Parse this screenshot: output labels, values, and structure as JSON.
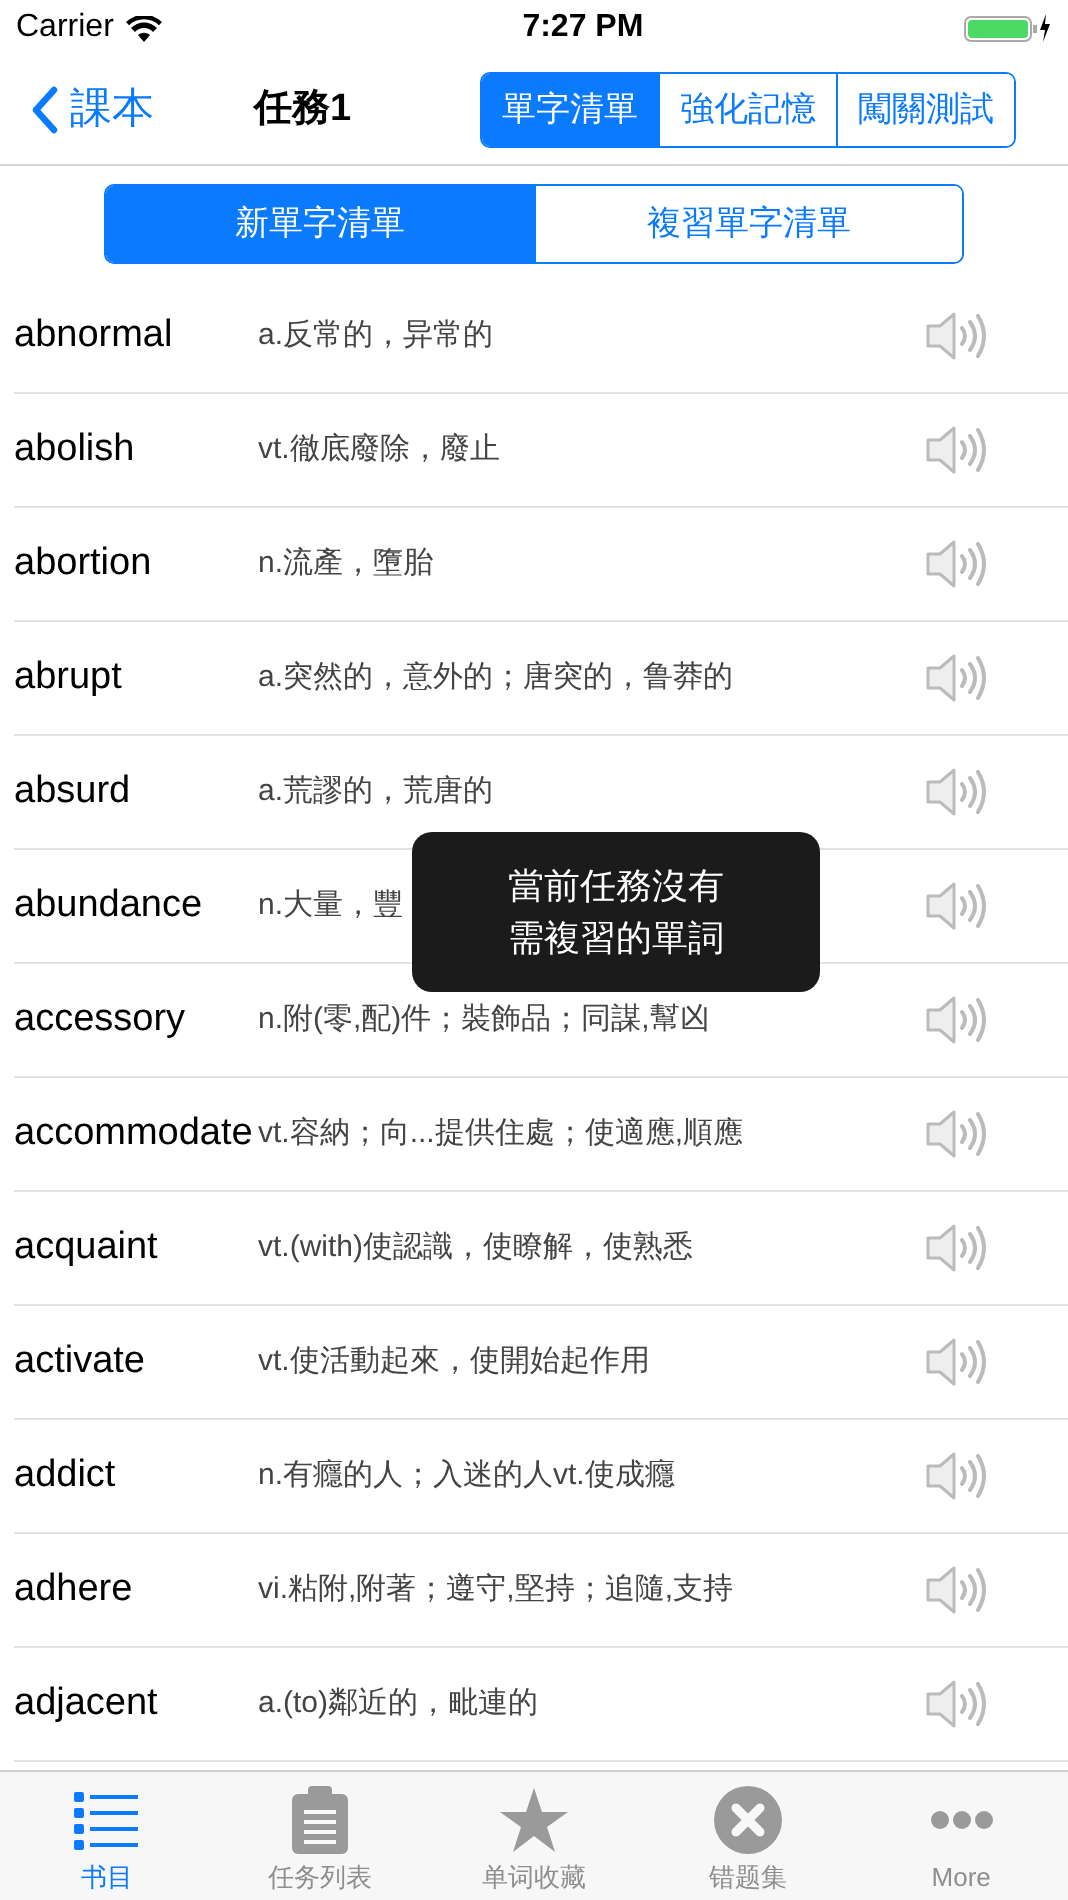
{
  "status_bar": {
    "carrier": "Carrier",
    "time": "7:27 PM"
  },
  "nav": {
    "back": "課本",
    "title": "任務1",
    "segments": [
      {
        "label": "單字清單",
        "selected": true
      },
      {
        "label": "強化記憶",
        "selected": false
      },
      {
        "label": "闖關測試",
        "selected": false
      }
    ]
  },
  "list_tabs": [
    {
      "label": "新單字清單",
      "selected": true
    },
    {
      "label": "複習單字清單",
      "selected": false
    }
  ],
  "words": [
    {
      "word": "abnormal",
      "definition": "a.反常的，异常的"
    },
    {
      "word": "abolish",
      "definition": "vt.徹底廢除，廢止"
    },
    {
      "word": "abortion",
      "definition": "n.流產，墮胎"
    },
    {
      "word": "abrupt",
      "definition": "a.突然的，意外的；唐突的，鲁莽的"
    },
    {
      "word": "absurd",
      "definition": "a.荒謬的，荒唐的"
    },
    {
      "word": "abundance",
      "definition": "n.大量，豐"
    },
    {
      "word": "accessory",
      "definition": "n.附(零,配)件；裝飾品；同謀,幫凶"
    },
    {
      "word": "accommodate",
      "definition": "vt.容納；向...提供住處；使適應,順應"
    },
    {
      "word": "acquaint",
      "definition": "vt.(with)使認識，使瞭解，使熟悉"
    },
    {
      "word": "activate",
      "definition": "vt.使活動起來，使開始起作用"
    },
    {
      "word": "addict",
      "definition": "n.有癮的人；入迷的人vt.使成癮"
    },
    {
      "word": "adhere",
      "definition": "vi.粘附,附著；遵守,堅持；追隨,支持"
    },
    {
      "word": "adjacent",
      "definition": "a.(to)鄰近的，毗連的"
    }
  ],
  "toast": {
    "lines": [
      "當前任務沒有",
      "需複習的單詞"
    ]
  },
  "tab_bar": [
    {
      "label": "书目",
      "kind": "list",
      "selected": true
    },
    {
      "label": "任务列表",
      "kind": "clipboard",
      "selected": false
    },
    {
      "label": "单词收藏",
      "kind": "star",
      "selected": false
    },
    {
      "label": "错题集",
      "kind": "cross",
      "selected": false
    },
    {
      "label": "More",
      "kind": "more",
      "selected": false
    }
  ]
}
